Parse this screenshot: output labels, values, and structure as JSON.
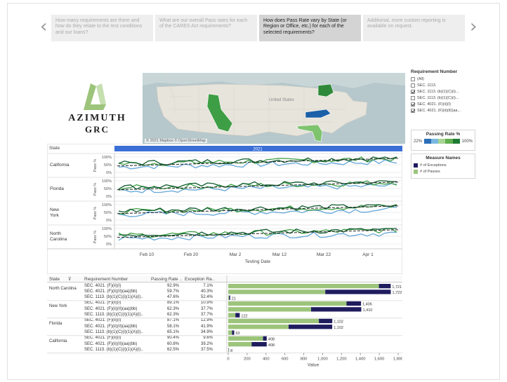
{
  "story": {
    "prev_arrow": "‹",
    "next_arrow": "›",
    "points": [
      {
        "text": "How many requirements are there and how do they relate to the test conditions and our loans?"
      },
      {
        "text": "What are our overall Pass rates for each of the CARES Act requirements?"
      },
      {
        "text": "How does Pass Rate vary by State (or Region or Office, etc.) for each of the selected requirements?"
      },
      {
        "text": "Additional, more custom reporting is available on request."
      }
    ]
  },
  "logo": {
    "line1": "AZIMUTH",
    "line2": "GRC"
  },
  "map": {
    "credit": "© 2021 Mapbox © OpenStreetMap",
    "label_us": "United States"
  },
  "filter": {
    "title": "Requirement Number",
    "items": [
      {
        "label": "(All)",
        "checked": false
      },
      {
        "label": "SEC. 1113.",
        "checked": false
      },
      {
        "label": "SEC. 1113. (b)(1)(C)(i)...",
        "checked": true
      },
      {
        "label": "SEC. 1113. (b)(1)(C)(i)...",
        "checked": false
      },
      {
        "label": "SEC. 4021. (F)(ii)(I)",
        "checked": true
      },
      {
        "label": "SEC. 4021. (F)(ii)(II)(aa...",
        "checked": true
      }
    ]
  },
  "rate_legend": {
    "title": "Passing Rate %",
    "min": "22%",
    "max": "100%"
  },
  "measure_legend": {
    "title": "Measure Names",
    "items": [
      {
        "label": "# of Exceptions",
        "color": "#1f1c5e"
      },
      {
        "label": "# of Passes",
        "color": "#9cc47b"
      }
    ]
  },
  "line_panel": {
    "col_header": "State",
    "year": "2021",
    "axis_label": "Pass %",
    "tick_labels": [
      "100%",
      "50%",
      "0%"
    ],
    "states": [
      "California",
      "Florida",
      "New York",
      "North Carolina"
    ],
    "x_ticks": [
      "Feb 10",
      "Feb 20",
      "Mar 2",
      "Mar 12",
      "Mar 22",
      "Apr 1"
    ],
    "x_title": "Testing Date"
  },
  "table": {
    "headers": [
      "State",
      "Requirement Number",
      "Passing Rate ..",
      "Exception Ra.."
    ],
    "groups": [
      {
        "state": "North Carolina",
        "rows": [
          {
            "req": "SEC. 4021. (F)(ii)(I)",
            "pass": "92.9%",
            "exc": "7.1%",
            "passes": 1596,
            "exceptions": 125,
            "label": "1,721"
          },
          {
            "req": "SEC. 4021. (F)(ii)(II)(aa)(bb)",
            "pass": "59.7%",
            "exc": "40.3%",
            "passes": 1028,
            "exceptions": 694,
            "label": "1,722"
          },
          {
            "req": "SEC. 1113. (b)(1)(C)(i)(1)(A)(i)..",
            "pass": "47.6%",
            "exc": "52.4%",
            "passes": 10,
            "exceptions": 11,
            "label": "21"
          }
        ]
      },
      {
        "state": "New York",
        "rows": [
          {
            "req": "SEC. 4021. (F)(ii)(I)",
            "pass": "89.1%",
            "exc": "10.9%",
            "passes": 1253,
            "exceptions": 153,
            "label": "1,406"
          },
          {
            "req": "SEC. 4021. (F)(ii)(II)(aa)(bb)",
            "pass": "62.3%",
            "exc": "37.7%",
            "passes": 878,
            "exceptions": 532,
            "label": "1,410"
          },
          {
            "req": "SEC. 1113. (b)(1)(C)(i)(1)(A)(i)..",
            "pass": "62.3%",
            "exc": "37.7%",
            "passes": 76,
            "exceptions": 46,
            "label": "122"
          }
        ]
      },
      {
        "state": "Florida",
        "rows": [
          {
            "req": "SEC. 4021. (F)(ii)(I)",
            "pass": "87.1%",
            "exc": "12.9%",
            "passes": 960,
            "exceptions": 142,
            "label": "1,102"
          },
          {
            "req": "SEC. 4021. (F)(ii)(II)(aa)(bb)",
            "pass": "58.1%",
            "exc": "41.9%",
            "passes": 640,
            "exceptions": 462,
            "label": "1,102"
          },
          {
            "req": "SEC. 1113. (b)(1)(C)(i)(1)(A)(i)..",
            "pass": "65.1%",
            "exc": "34.9%",
            "passes": 41,
            "exceptions": 22,
            "label": "63"
          }
        ]
      },
      {
        "state": "California",
        "rows": [
          {
            "req": "SEC. 4021. (F)(ii)(I)",
            "pass": "90.4%",
            "exc": "9.6%",
            "passes": 369,
            "exceptions": 39,
            "label": "408"
          },
          {
            "req": "SEC. 4021. (F)(ii)(II)(aa)(bb)",
            "pass": "60.8%",
            "exc": "39.2%",
            "passes": 248,
            "exceptions": 160,
            "label": "408"
          },
          {
            "req": "SEC. 1113. (b)(1)(C)(i)(1)(A)(i)..",
            "pass": "62.5%",
            "exc": "37.5%",
            "passes": 5,
            "exceptions": 3,
            "label": "8"
          }
        ]
      }
    ],
    "x_ticks": [
      "0",
      "200",
      "400",
      "600",
      "800",
      "1,000",
      "1,200",
      "1,400",
      "1,600",
      "1,800"
    ],
    "x_title": "Value"
  },
  "colors": {
    "passes": "#9cc47b",
    "exceptions": "#1f1c5e",
    "year_bar": "#3b6fd6",
    "line_light": "#63a6d8",
    "line_green": "#3e9e45",
    "line_dark": "#0f5b2e"
  },
  "chart_data": {
    "type": "bar",
    "categories": [
      "North Carolina | SEC. 4021. (F)(ii)(I)",
      "North Carolina | SEC. 4021. (F)(ii)(II)(aa)(bb)",
      "North Carolina | SEC. 1113. (b)(1)(C)(i)(1)(A)(i)..",
      "New York | SEC. 4021. (F)(ii)(I)",
      "New York | SEC. 4021. (F)(ii)(II)(aa)(bb)",
      "New York | SEC. 1113. (b)(1)(C)(i)(1)(A)(i)..",
      "Florida | SEC. 4021. (F)(ii)(I)",
      "Florida | SEC. 4021. (F)(ii)(II)(aa)(bb)",
      "Florida | SEC. 1113. (b)(1)(C)(i)(1)(A)(i)..",
      "California | SEC. 4021. (F)(ii)(I)",
      "California | SEC. 4021. (F)(ii)(II)(aa)(bb)",
      "California | SEC. 1113. (b)(1)(C)(i)(1)(A)(i).."
    ],
    "series": [
      {
        "name": "# of Passes",
        "values": [
          1596,
          1028,
          10,
          1253,
          878,
          76,
          960,
          640,
          41,
          369,
          248,
          5
        ]
      },
      {
        "name": "# of Exceptions",
        "values": [
          125,
          694,
          11,
          153,
          532,
          46,
          142,
          462,
          22,
          39,
          160,
          3
        ]
      }
    ],
    "xlabel": "Value",
    "xlim": [
      0,
      1800
    ],
    "stacked": true
  }
}
